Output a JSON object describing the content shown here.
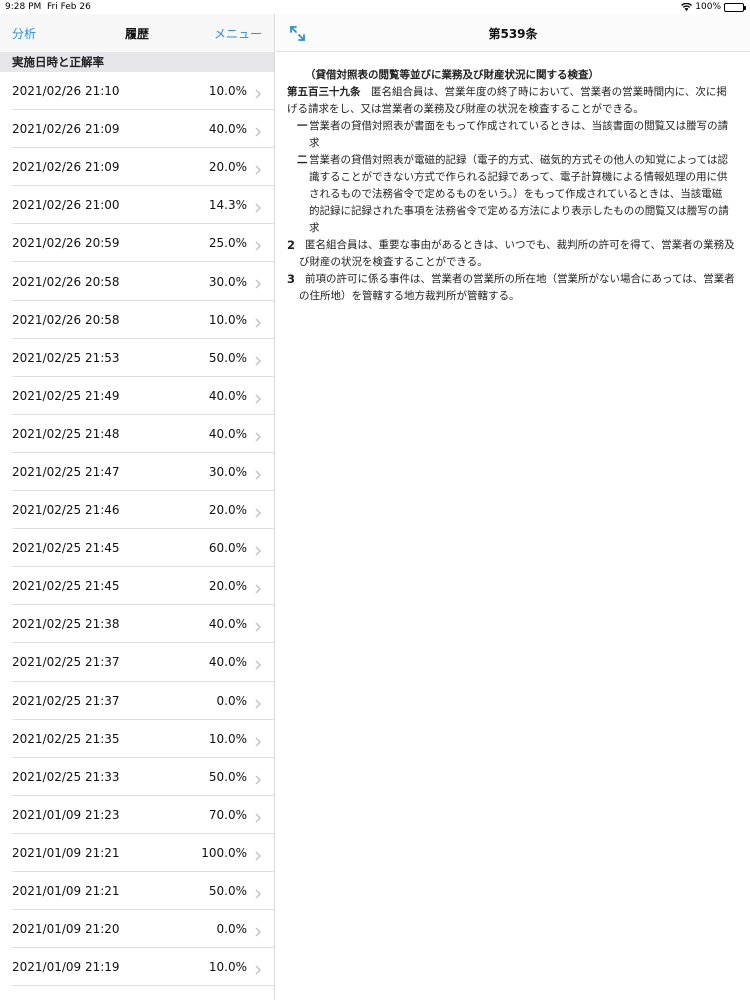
{
  "status": {
    "time": "9:28 PM",
    "date": "Fri Feb 26",
    "battery": "100%"
  },
  "left": {
    "nav": {
      "left_button": "分析",
      "title": "履歴",
      "right_button": "メニュー"
    },
    "section_header": "実施日時と正解率",
    "rows": [
      {
        "date": "2021/02/26 21:10",
        "pct": "10.0%"
      },
      {
        "date": "2021/02/26 21:09",
        "pct": "40.0%"
      },
      {
        "date": "2021/02/26 21:09",
        "pct": "20.0%"
      },
      {
        "date": "2021/02/26 21:00",
        "pct": "14.3%"
      },
      {
        "date": "2021/02/26 20:59",
        "pct": "25.0%"
      },
      {
        "date": "2021/02/26 20:58",
        "pct": "30.0%"
      },
      {
        "date": "2021/02/26 20:58",
        "pct": "10.0%"
      },
      {
        "date": "2021/02/25 21:53",
        "pct": "50.0%"
      },
      {
        "date": "2021/02/25 21:49",
        "pct": "40.0%"
      },
      {
        "date": "2021/02/25 21:48",
        "pct": "40.0%"
      },
      {
        "date": "2021/02/25 21:47",
        "pct": "30.0%"
      },
      {
        "date": "2021/02/25 21:46",
        "pct": "20.0%"
      },
      {
        "date": "2021/02/25 21:45",
        "pct": "60.0%"
      },
      {
        "date": "2021/02/25 21:45",
        "pct": "20.0%"
      },
      {
        "date": "2021/02/25 21:38",
        "pct": "40.0%"
      },
      {
        "date": "2021/02/25 21:37",
        "pct": "40.0%"
      },
      {
        "date": "2021/02/25 21:37",
        "pct": "0.0%"
      },
      {
        "date": "2021/02/25 21:35",
        "pct": "10.0%"
      },
      {
        "date": "2021/02/25 21:33",
        "pct": "50.0%"
      },
      {
        "date": "2021/01/09 21:23",
        "pct": "70.0%"
      },
      {
        "date": "2021/01/09 21:21",
        "pct": "100.0%"
      },
      {
        "date": "2021/01/09 21:21",
        "pct": "50.0%"
      },
      {
        "date": "2021/01/09 21:20",
        "pct": "0.0%"
      },
      {
        "date": "2021/01/09 21:19",
        "pct": "10.0%"
      }
    ]
  },
  "right": {
    "title": "第539条",
    "caption": "（貸借対照表の閲覧等並びに業務及び財産状況に関する検査）",
    "article_number": "第五百三十九条",
    "para1": "　匿名組合員は、営業年度の終了時において、営業者の営業時間内に、次に掲げる請求をし、又は営業者の業務及び財産の状況を検査することができる。",
    "items": [
      {
        "num": "一",
        "text": "営業者の貸借対照表が書面をもって作成されているときは、当該書面の閲覧又は謄写の請求"
      },
      {
        "num": "二",
        "text": "営業者の貸借対照表が電磁的記録（電子的方式、磁気的方式その他人の知覚によっては認識することができない方式で作られる記録であって、電子計算機による情報処理の用に供されるもので法務省令で定めるものをいう。）をもって作成されているときは、当該電磁的記録に記録された事項を法務省令で定める方法により表示したものの閲覧又は謄写の請求"
      }
    ],
    "paragraphs": [
      {
        "num": "2",
        "text": "匿名組合員は、重要な事由があるときは、いつでも、裁判所の許可を得て、営業者の業務及び財産の状況を検査することができる。"
      },
      {
        "num": "3",
        "text": "前項の許可に係る事件は、営業者の営業所の所在地（営業所がない場合にあっては、営業者の住所地）を管轄する地方裁判所が管轄する。"
      }
    ]
  },
  "colors": {
    "accent": "#2f8fd8",
    "section_bg": "#e5e5ea"
  }
}
